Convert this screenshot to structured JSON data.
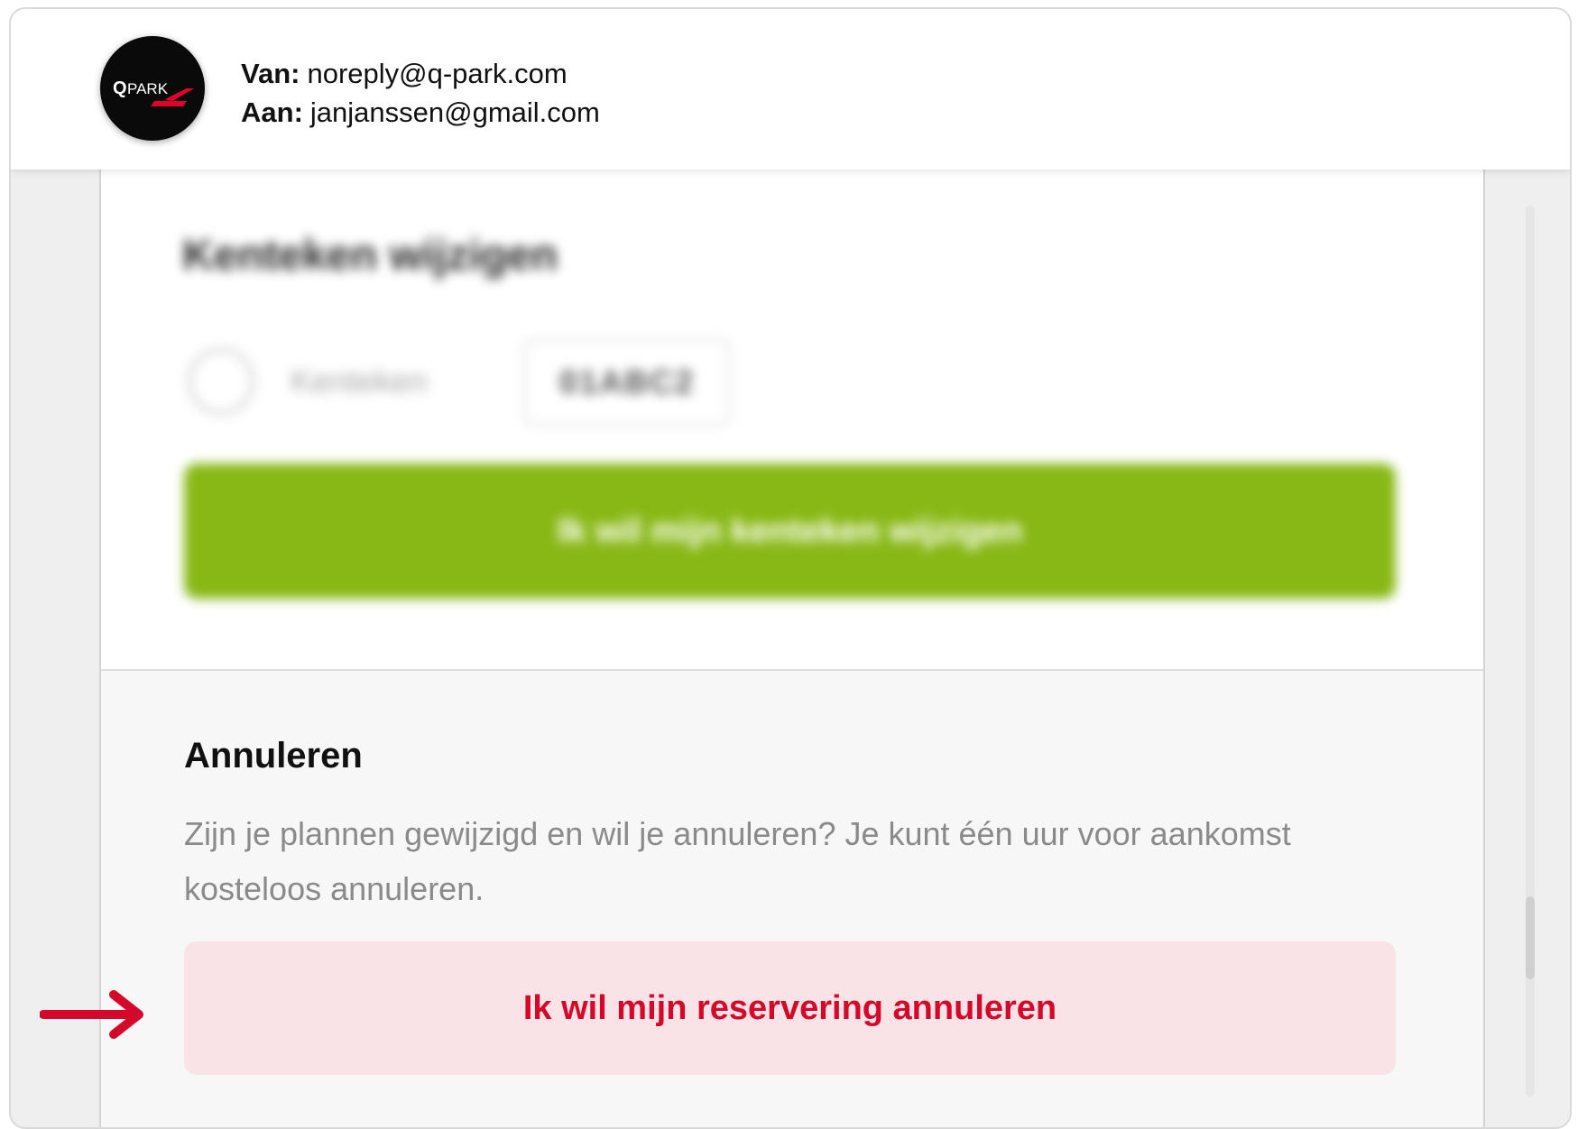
{
  "header": {
    "logo_text": "QPARK",
    "from_label": "Van:",
    "from_value": "noreply@q-park.com",
    "to_label": "Aan:",
    "to_value": "janjanssen@gmail.com"
  },
  "plate_section": {
    "title": "Kenteken wijzigen",
    "plate_label": "Kenteken",
    "plate_value": "01ABC2",
    "change_button": "Ik wil mijn kenteken wijzigen"
  },
  "cancel_section": {
    "heading": "Annuleren",
    "description": "Zijn je plannen gewijzigd en wil je annuleren? Je kunt één uur voor aankomst kosteloos annuleren.",
    "cancel_button": "Ik wil mijn reservering annuleren"
  },
  "colors": {
    "brand_green": "#88b815",
    "cancel_red": "#d4082a",
    "cancel_bg": "#fae3e6",
    "arrow_red": "#d4082a"
  },
  "icons": [
    "qpark-logo",
    "car-icon",
    "arrow-right-icon"
  ]
}
